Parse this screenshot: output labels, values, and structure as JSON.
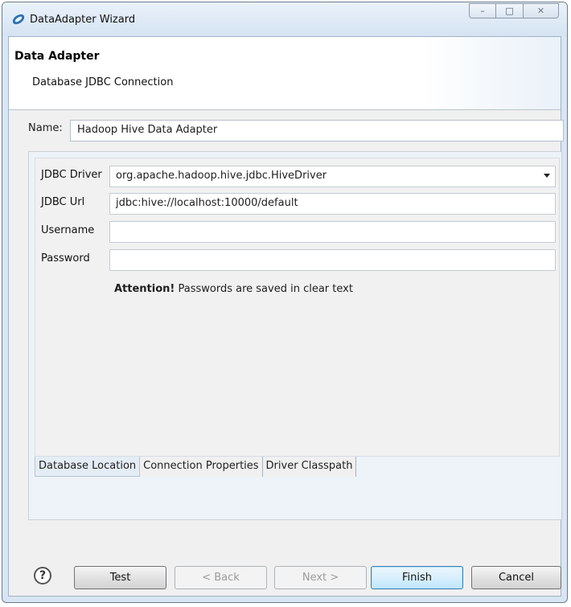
{
  "window": {
    "title": "DataAdapter Wizard",
    "controls": {
      "minimize": "–",
      "maximize": "□",
      "close": "✕"
    }
  },
  "header": {
    "title": "Data Adapter",
    "subtitle": "Database JDBC Connection"
  },
  "name_field": {
    "label": "Name:",
    "value": "Hadoop Hive Data Adapter"
  },
  "form": {
    "driver": {
      "label": "JDBC Driver",
      "value": "org.apache.hadoop.hive.jdbc.HiveDriver"
    },
    "url": {
      "label": "JDBC Url",
      "value": "jdbc:hive://localhost:10000/default"
    },
    "username": {
      "label": "Username",
      "value": ""
    },
    "password": {
      "label": "Password",
      "value": ""
    },
    "attention_bold": "Attention!",
    "attention_text": " Passwords are saved in clear text"
  },
  "tabs": [
    {
      "label": "Database Location",
      "active": true
    },
    {
      "label": "Connection Properties",
      "active": false
    },
    {
      "label": "Driver Classpath",
      "active": false
    }
  ],
  "buttons": {
    "help": "?",
    "test": "Test",
    "back": "< Back",
    "next": "Next >",
    "finish": "Finish",
    "cancel": "Cancel"
  },
  "colors": {
    "window_frame": "#d8e5f3",
    "dialog_bg": "#f0f0f0",
    "default_button": "#3c7fb1"
  }
}
